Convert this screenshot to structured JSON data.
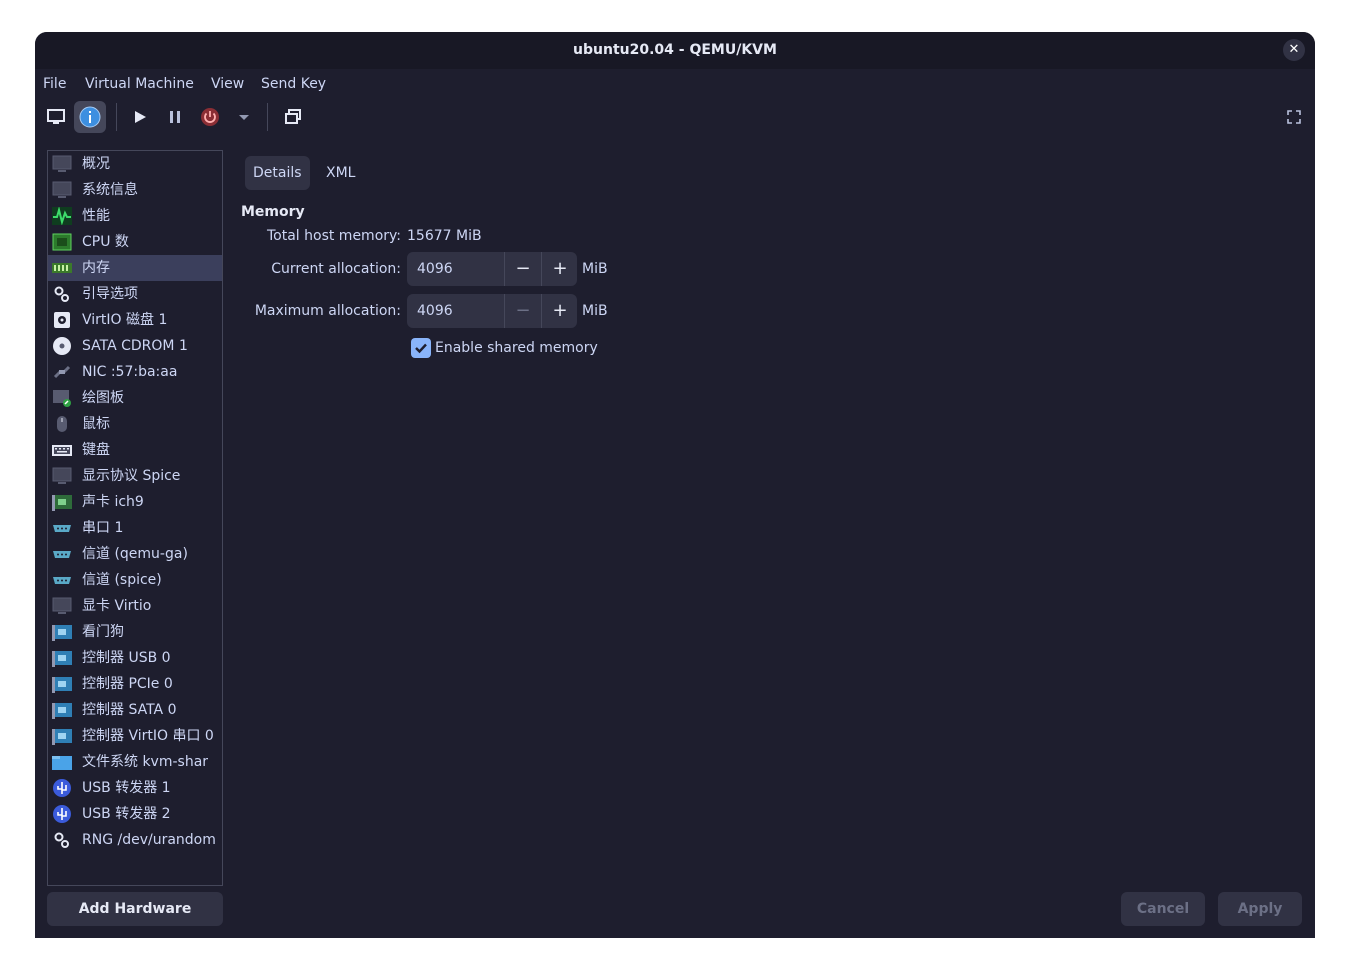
{
  "window": {
    "title": "ubuntu20.04 - QEMU/KVM"
  },
  "menu": [
    "File",
    "Virtual Machine",
    "View",
    "Send Key"
  ],
  "toolbar": {
    "icons": [
      "monitor-icon",
      "info-icon",
      "play-icon",
      "pause-icon",
      "power-icon",
      "dropdown-icon",
      "windows-icon",
      "fullscreen-icon"
    ]
  },
  "sidebar": {
    "items": [
      {
        "label": "概况",
        "icon": "overview-icon"
      },
      {
        "label": "系统信息",
        "icon": "system-info-icon"
      },
      {
        "label": "性能",
        "icon": "performance-icon"
      },
      {
        "label": "CPU 数",
        "icon": "cpu-icon"
      },
      {
        "label": "内存",
        "icon": "memory-icon"
      },
      {
        "label": "引导选项",
        "icon": "boot-icon"
      },
      {
        "label": "VirtIO 磁盘 1",
        "icon": "disk-icon"
      },
      {
        "label": "SATA CDROM 1",
        "icon": "cdrom-icon"
      },
      {
        "label": "NIC :57:ba:aa",
        "icon": "network-icon"
      },
      {
        "label": "绘图板",
        "icon": "tablet-icon"
      },
      {
        "label": "鼠标",
        "icon": "mouse-icon"
      },
      {
        "label": "键盘",
        "icon": "keyboard-icon"
      },
      {
        "label": "显示协议 Spice",
        "icon": "display-icon"
      },
      {
        "label": "声卡 ich9",
        "icon": "sound-card-icon"
      },
      {
        "label": "串口 1",
        "icon": "serial-icon"
      },
      {
        "label": "信道 (qemu-ga)",
        "icon": "channel-icon"
      },
      {
        "label": "信道 (spice)",
        "icon": "channel-icon"
      },
      {
        "label": "显卡 Virtio",
        "icon": "video-icon"
      },
      {
        "label": "看门狗",
        "icon": "watchdog-icon"
      },
      {
        "label": "控制器 USB 0",
        "icon": "controller-icon"
      },
      {
        "label": "控制器 PCIe 0",
        "icon": "controller-icon"
      },
      {
        "label": "控制器 SATA 0",
        "icon": "controller-icon"
      },
      {
        "label": "控制器 VirtIO 串口 0",
        "icon": "controller-icon"
      },
      {
        "label": "文件系统 kvm-shar",
        "icon": "filesystem-icon"
      },
      {
        "label": "USB 转发器 1",
        "icon": "usb-icon"
      },
      {
        "label": "USB 转发器 2",
        "icon": "usb-icon"
      },
      {
        "label": "RNG /dev/urandom",
        "icon": "rng-icon"
      }
    ],
    "selected_index": 4,
    "add_hardware": "Add Hardware"
  },
  "tabs": [
    "Details",
    "XML"
  ],
  "memory": {
    "section_title": "Memory",
    "total_label": "Total host memory:",
    "total_value": "15677 MiB",
    "current_label": "Current allocation:",
    "current_value": "4096",
    "max_label": "Maximum allocation:",
    "max_value": "4096",
    "unit": "MiB",
    "minus": "−",
    "plus": "+",
    "shared_label": "Enable shared memory",
    "shared_checked": true
  },
  "footer": {
    "cancel": "Cancel",
    "apply": "Apply"
  },
  "colors": {
    "background": "#1e1e2e",
    "accent": "#89b4fa",
    "selected": "#3b3f5c"
  }
}
